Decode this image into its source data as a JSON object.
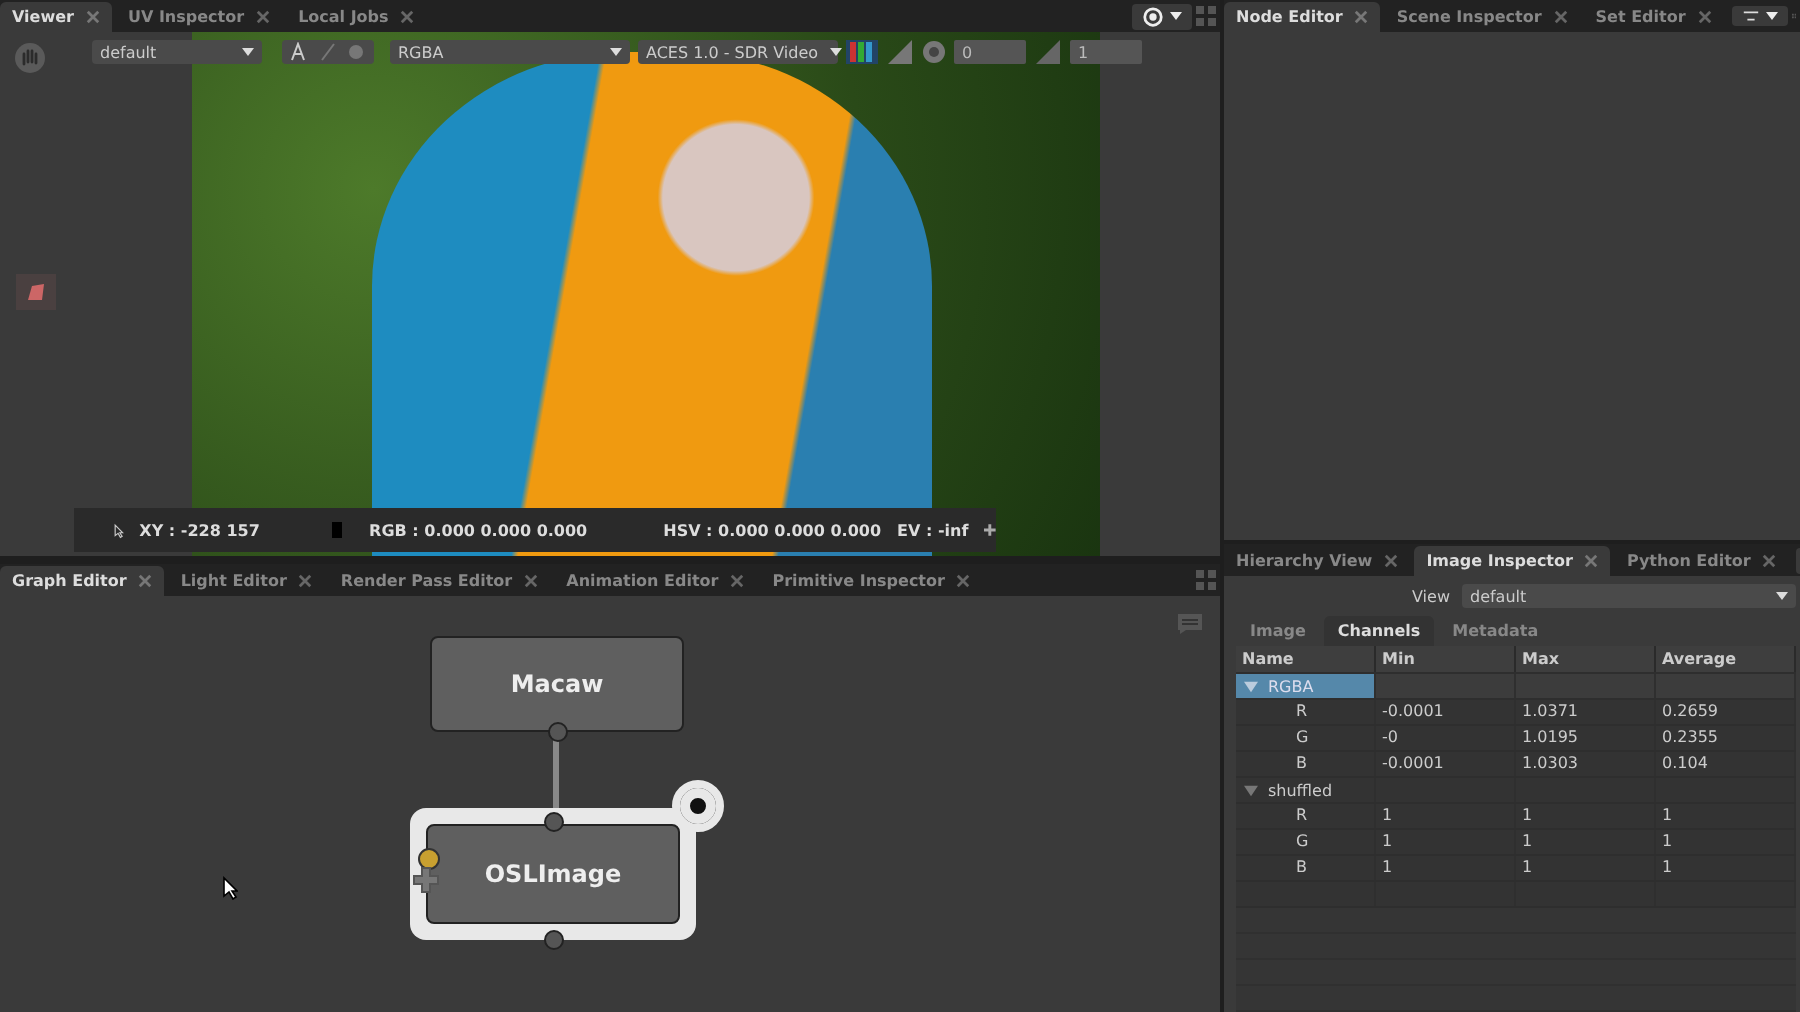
{
  "viewer": {
    "tabs": [
      {
        "label": "Viewer",
        "selected": true
      },
      {
        "label": "UV Inspector",
        "selected": false
      },
      {
        "label": "Local Jobs",
        "selected": false
      }
    ],
    "toolbar": {
      "layer": "default",
      "channels": "RGBA",
      "display": "ACES 1.0 - SDR Video",
      "exposure": "0",
      "gamma": "1"
    },
    "hud": {
      "xy": "XY : -228 157",
      "rgb": "RGB : 0.000 0.000 0.000",
      "hsv": "HSV : 0.000 0.000 0.000",
      "ev": "EV : -inf"
    }
  },
  "node_editor": {
    "tabs": [
      {
        "label": "Node Editor",
        "selected": true
      },
      {
        "label": "Scene Inspector",
        "selected": false
      },
      {
        "label": "Set Editor",
        "selected": false
      }
    ]
  },
  "graph_editor": {
    "tabs": [
      {
        "label": "Graph Editor",
        "selected": true
      },
      {
        "label": "Light Editor",
        "selected": false
      },
      {
        "label": "Render Pass Editor",
        "selected": false
      },
      {
        "label": "Animation Editor",
        "selected": false
      },
      {
        "label": "Primitive Inspector",
        "selected": false
      }
    ],
    "nodes": [
      {
        "label": "Macaw",
        "selected": false
      },
      {
        "label": "OSLImage",
        "selected": true
      }
    ]
  },
  "image_inspector": {
    "tabs": [
      {
        "label": "Hierarchy View",
        "selected": false
      },
      {
        "label": "Image Inspector",
        "selected": true
      },
      {
        "label": "Python Editor",
        "selected": false
      }
    ],
    "view_label": "View",
    "view_value": "default",
    "subtabs": [
      {
        "label": "Image",
        "selected": false
      },
      {
        "label": "Channels",
        "selected": true
      },
      {
        "label": "Metadata",
        "selected": false
      }
    ],
    "columns": [
      "Name",
      "Min",
      "Max",
      "Average"
    ],
    "groups": [
      {
        "name": "RGBA",
        "expanded": true,
        "selected": true,
        "children": [
          {
            "name": "R",
            "min": "-0.0001",
            "max": "1.0371",
            "average": "0.2659"
          },
          {
            "name": "G",
            "min": "-0",
            "max": "1.0195",
            "average": "0.2355"
          },
          {
            "name": "B",
            "min": "-0.0001",
            "max": "1.0303",
            "average": "0.104"
          }
        ]
      },
      {
        "name": "shuffled",
        "expanded": true,
        "selected": false,
        "children": [
          {
            "name": "R",
            "min": "1",
            "max": "1",
            "average": "1"
          },
          {
            "name": "G",
            "min": "1",
            "max": "1",
            "average": "1"
          },
          {
            "name": "B",
            "min": "1",
            "max": "1",
            "average": "1"
          }
        ]
      }
    ]
  }
}
